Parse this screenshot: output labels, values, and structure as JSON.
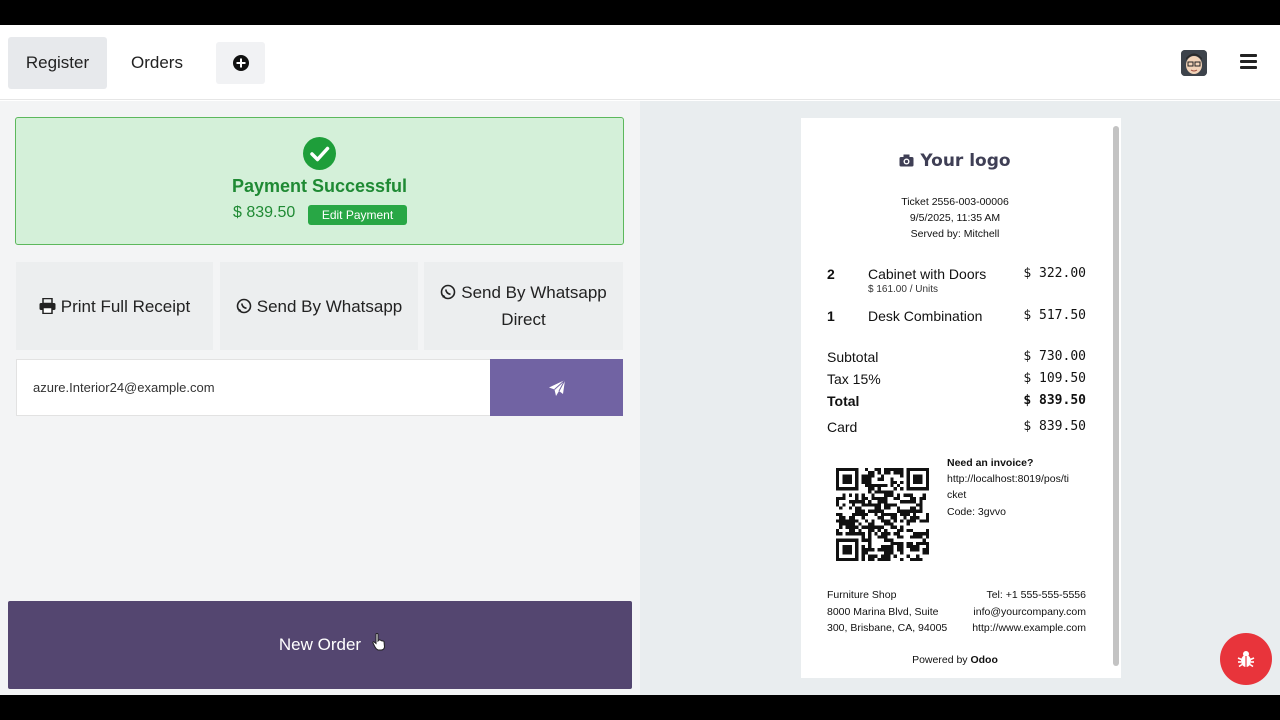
{
  "tabs": {
    "register": "Register",
    "orders": "Orders"
  },
  "payment": {
    "title": "Payment Successful",
    "amount": "$ 839.50",
    "edit_label": "Edit Payment"
  },
  "actions": {
    "print": "Print Full Receipt",
    "whatsapp": "Send By Whatsapp",
    "whatsapp_direct_1": "Send By Whatsapp",
    "whatsapp_direct_2": "Direct"
  },
  "email": {
    "value": "azure.Interior24@example.com"
  },
  "new_order": "New Order",
  "receipt": {
    "logo": "Your logo",
    "ticket": "Ticket 2556-003-00006",
    "datetime": "9/5/2025, 11:35 AM",
    "served_by": "Served by: Mitchell",
    "lines": [
      {
        "qty": "2",
        "name": "Cabinet with Doors",
        "sub": "$ 161.00 / Units",
        "price": "$ 322.00"
      },
      {
        "qty": "1",
        "name": "Desk Combination",
        "sub": "",
        "price": "$ 517.50"
      }
    ],
    "subtotal_label": "Subtotal",
    "subtotal": "$ 730.00",
    "tax_label": "Tax 15%",
    "tax": "$ 109.50",
    "total_label": "Total",
    "total": "$ 839.50",
    "card_label": "Card",
    "card": "$ 839.50",
    "invoice_title": "Need an invoice?",
    "invoice_url_1": "http://localhost:8019/pos/ti",
    "invoice_url_2": "cket",
    "invoice_code": "Code: 3gvvo",
    "shop_name": "Furniture Shop",
    "address_1": "8000 Marina Blvd, Suite",
    "address_2": "300, Brisbane, CA, 94005",
    "tel": "Tel: +1 555-555-5556",
    "email": "info@yourcompany.com",
    "website": "http://www.example.com",
    "powered_by": "Powered by",
    "powered_brand": "Odoo"
  },
  "colors": {
    "success_bg": "#d4f0d9",
    "success_text": "#1f8a34",
    "accent": "#7163a3",
    "new_order_bg": "#544670",
    "debug_button": "#e8343b"
  }
}
